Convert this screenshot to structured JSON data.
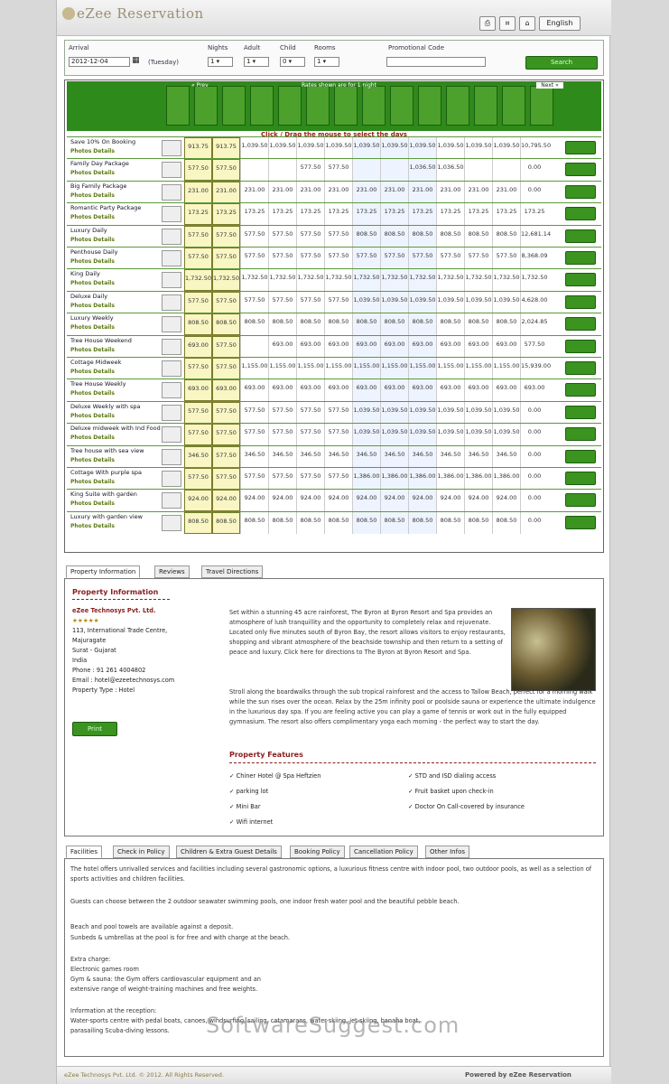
{
  "app": {
    "title": "eZee Reservation",
    "language": "English"
  },
  "search": {
    "arrival_label": "Arrival",
    "arrival_value": "2012-12-04",
    "arrival_day": "(Tuesday)",
    "nights_label": "Nights",
    "adult_label": "Adult",
    "child_label": "Child",
    "rooms_label": "Rooms",
    "promo_label": "Promotional Code",
    "search_button": "Search"
  },
  "calendar": {
    "prev": "« Prev",
    "next": "Next »",
    "rate_notice": "Rates shown are for 1 night",
    "hint": "Click / Drag the mouse to select the days"
  },
  "rooms": [
    {
      "name": "Save 10% On Booking",
      "rates": [
        "913.75",
        "913.75",
        "1,039.50",
        "1,039.50",
        "1,039.50",
        "1,039.50",
        "1,039.50",
        "1,039.50",
        "1,039.50",
        "1,039.50",
        "1,039.50",
        "1,039.50",
        "10,795.50"
      ]
    },
    {
      "name": "Family Day Package",
      "rates": [
        "577.50",
        "577.50",
        "",
        "",
        "577.50",
        "577.50",
        "",
        "",
        "1,036.50",
        "1,036.50",
        "",
        "",
        "0.00"
      ]
    },
    {
      "name": "Big Family Package",
      "rates": [
        "231.00",
        "231.00",
        "231.00",
        "231.00",
        "231.00",
        "231.00",
        "231.00",
        "231.00",
        "231.00",
        "231.00",
        "231.00",
        "231.00",
        "0.00"
      ]
    },
    {
      "name": "Romantic Party Package",
      "rates": [
        "173.25",
        "173.25",
        "173.25",
        "173.25",
        "173.25",
        "173.25",
        "173.25",
        "173.25",
        "173.25",
        "173.25",
        "173.25",
        "173.25",
        "173.25"
      ]
    },
    {
      "name": "Luxury Daily",
      "rates": [
        "577.50",
        "577.50",
        "577.50",
        "577.50",
        "577.50",
        "577.50",
        "808.50",
        "808.50",
        "808.50",
        "808.50",
        "808.50",
        "808.50",
        "12,681.14"
      ]
    },
    {
      "name": "Penthouse Daily",
      "rates": [
        "577.50",
        "577.50",
        "577.50",
        "577.50",
        "577.50",
        "577.50",
        "577.50",
        "577.50",
        "577.50",
        "577.50",
        "577.50",
        "577.50",
        "8,368.09"
      ]
    },
    {
      "name": "King Daily",
      "rates": [
        "1,732.50",
        "1,732.50",
        "1,732.50",
        "1,732.50",
        "1,732.50",
        "1,732.50",
        "1,732.50",
        "1,732.50",
        "1,732.50",
        "1,732.50",
        "1,732.50",
        "1,732.50",
        "1,732.50"
      ]
    },
    {
      "name": "Deluxe Daily",
      "rates": [
        "577.50",
        "577.50",
        "577.50",
        "577.50",
        "577.50",
        "577.50",
        "1,039.50",
        "1,039.50",
        "1,039.50",
        "1,039.50",
        "1,039.50",
        "1,039.50",
        "4,628.00"
      ]
    },
    {
      "name": "Luxury Weekly",
      "rates": [
        "808.50",
        "808.50",
        "808.50",
        "808.50",
        "808.50",
        "808.50",
        "808.50",
        "808.50",
        "808.50",
        "808.50",
        "808.50",
        "808.50",
        "2,024.85"
      ]
    },
    {
      "name": "Tree House Weekend",
      "rates": [
        "693.00",
        "577.50",
        "",
        "693.00",
        "693.00",
        "693.00",
        "693.00",
        "693.00",
        "693.00",
        "693.00",
        "693.00",
        "693.00",
        "577.50"
      ]
    },
    {
      "name": "Cottage Midweek",
      "rates": [
        "577.50",
        "577.50",
        "1,155.00",
        "1,155.00",
        "1,155.00",
        "1,155.00",
        "1,155.00",
        "1,155.00",
        "1,155.00",
        "1,155.00",
        "1,155.00",
        "1,155.00",
        "15,939.00"
      ]
    },
    {
      "name": "Tree House Weekly",
      "rates": [
        "693.00",
        "693.00",
        "693.00",
        "693.00",
        "693.00",
        "693.00",
        "693.00",
        "693.00",
        "693.00",
        "693.00",
        "693.00",
        "693.00",
        "693.00"
      ]
    },
    {
      "name": "Deluxe Weekly with spa",
      "rates": [
        "577.50",
        "577.50",
        "577.50",
        "577.50",
        "577.50",
        "577.50",
        "1,039.50",
        "1,039.50",
        "1,039.50",
        "1,039.50",
        "1,039.50",
        "1,039.50",
        "0.00"
      ]
    },
    {
      "name": "Deluxe midweek with Ind Food",
      "rates": [
        "577.50",
        "577.50",
        "577.50",
        "577.50",
        "577.50",
        "577.50",
        "1,039.50",
        "1,039.50",
        "1,039.50",
        "1,039.50",
        "1,039.50",
        "1,039.50",
        "0.00"
      ]
    },
    {
      "name": "Tree house with sea view",
      "rates": [
        "346.50",
        "577.50",
        "346.50",
        "346.50",
        "346.50",
        "346.50",
        "346.50",
        "346.50",
        "346.50",
        "346.50",
        "346.50",
        "346.50",
        "0.00"
      ]
    },
    {
      "name": "Cottage With purple spa",
      "rates": [
        "577.50",
        "577.50",
        "577.50",
        "577.50",
        "577.50",
        "577.50",
        "1,386.00",
        "1,386.00",
        "1,386.00",
        "1,386.00",
        "1,386.00",
        "1,386.00",
        "0.00"
      ]
    },
    {
      "name": "King Suite with garden",
      "rates": [
        "924.00",
        "924.00",
        "924.00",
        "924.00",
        "924.00",
        "924.00",
        "924.00",
        "924.00",
        "924.00",
        "924.00",
        "924.00",
        "924.00",
        "0.00"
      ]
    },
    {
      "name": "Luxury with garden view",
      "rates": [
        "808.50",
        "808.50",
        "808.50",
        "808.50",
        "808.50",
        "808.50",
        "808.50",
        "808.50",
        "808.50",
        "808.50",
        "808.50",
        "808.50",
        "0.00"
      ]
    }
  ],
  "row_links": {
    "photos": "Photos",
    "details": "Details"
  },
  "property_tabs": [
    "Property Information",
    "Reviews",
    "Travel Directions"
  ],
  "property": {
    "heading": "Property Information",
    "company": "eZee Technosys Pvt. Ltd.",
    "stars": "★★★★★",
    "address": [
      "113, International Trade Centre,",
      "Majuragate",
      "Surat - Gujarat",
      "India"
    ],
    "phone": "Phone : 91 261 4004802",
    "email": "Email : hotel@ezeetechnosys.com",
    "type": "Property Type : Hotel",
    "desc1": "Set within a stunning 45 acre rainforest, The Byron at Byron Resort and Spa provides an atmosphere of lush tranquillity and the opportunity to completely relax and rejuvenate. Located only five minutes south of Byron Bay, the resort allows visitors to enjoy restaurants, shopping and vibrant atmosphere of the beachside township and then return to a setting of peace and luxury. Click here for directions to The Byron at Byron Resort and Spa.",
    "desc2": "Stroll along the boardwalks through the sub tropical rainforest and the access to Tallow Beach, perfect for a morning walk while the sun rises over the ocean. Relax by the 25m infinity pool or poolside sauna or experience the ultimate indulgence in the luxurious day spa. If you are feeling active you can play a game of tennis or work out in the fully equipped gymnasium. The resort also offers complimentary yoga each morning - the perfect way to start the day.",
    "features_heading": "Property Features",
    "features_left": [
      "Chiner Hotel @ Spa Heftzien",
      "parking lot",
      "Mini Bar",
      "Wifi internet"
    ],
    "features_right": [
      "STD and ISD dialing access",
      "Fruit basket upon check-in",
      "Doctor On Call-covered by insurance"
    ],
    "button": "Print"
  },
  "facility_tabs": [
    "Facilities",
    "Check in Policy",
    "Children & Extra Guest Details",
    "Booking Policy",
    "Cancellation Policy",
    "Other Infos"
  ],
  "facilities": [
    "The hotel offers unrivalled services and facilities including several gastronomic options, a luxurious fitness centre with indoor pool, two outdoor pools, as well as a selection of sports activities and children facilities.",
    "Guests can choose between the 2 outdoor seawater swimming pools, one indoor fresh water pool and the beautiful pebble beach.",
    "Beach and pool towels are available against a deposit.",
    "Sunbeds & umbrellas at the pool is for free and with charge at the beach.",
    "Extra charge:",
    "Electronic games room",
    "Gym & sauna: the Gym offers cardiovascular equipment and an",
    "extensive range of weight-training machines and free weights.",
    "Information at the reception:",
    "Water-sports centre with pedal boats, canoes, windsurfing, sailing, catamarans, water-skiing, jet-skiing, banana boat,",
    "parasailing Scuba-diving lessons."
  ],
  "watermark": "SoftwareSuggest.com",
  "footer": {
    "left": "eZee Technosys Pvt. Ltd. © 2012. All Rights Reserved.",
    "right": "Powered by eZee Reservation"
  },
  "colors": {
    "banner": "#2e8a1a",
    "book_button": "#3a941f",
    "heading": "#8a1e1e"
  }
}
